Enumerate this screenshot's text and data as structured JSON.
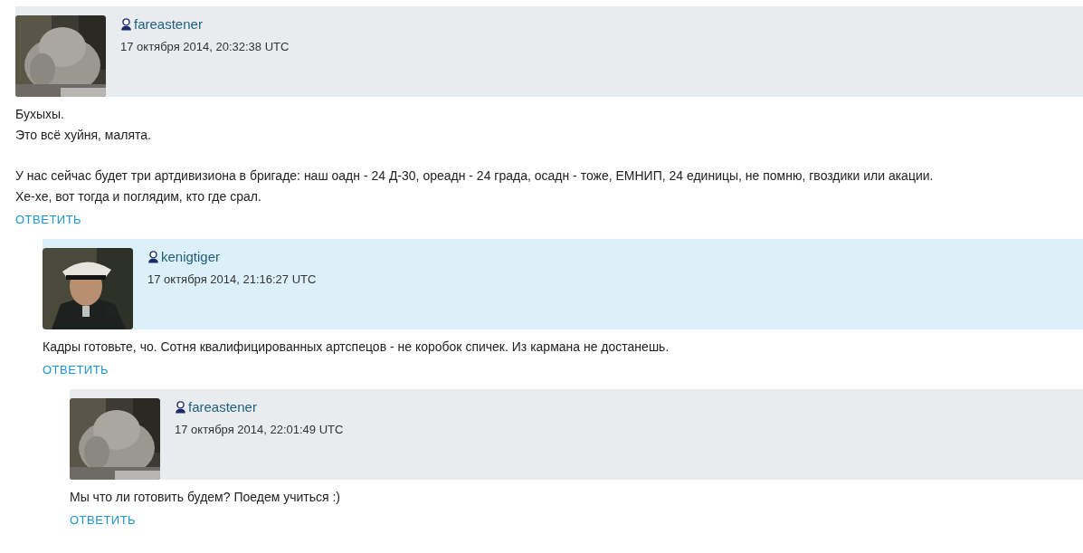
{
  "comments": [
    {
      "author": "fareastener",
      "date": "17 октября 2014, 20:32:38 UTC",
      "highlighted": false,
      "avatar": {
        "kind": "picture"
      },
      "paragraphs": [
        [
          "Бухыхы.",
          "Это всё хуйня, малята."
        ],
        [
          "У нас сейчас будет три артдивизиона в бригаде: наш оадн - 24 Д-30, ореадн - 24 града, осадн - тоже, ЕМНИП, 24 единицы, не помню, гвоздики или акации.",
          "Хе-хе, вот тогда и поглядим, кто где срал."
        ]
      ],
      "reply": "ОТВЕТИТЬ",
      "children": [
        {
          "author": "kenigtiger",
          "date": "17 октября 2014, 21:16:27 UTC",
          "highlighted": true,
          "avatar": {
            "kind": "picture"
          },
          "paragraphs": [
            [
              "Кадры готовьте, чо. Сотня квалифицированных артспецов - не коробок спичек. Из кармана не достанешь."
            ]
          ],
          "reply": "ОТВЕТИТЬ",
          "children": [
            {
              "author": "fareastener",
              "date": "17 октября 2014, 22:01:49 UTC",
              "highlighted": false,
              "avatar": {
                "kind": "picture"
              },
              "paragraphs": [
                [
                  "Мы что ли готовить будем? Поедем учиться :)"
                ]
              ],
              "reply": "ОТВЕТИТЬ"
            }
          ]
        }
      ]
    }
  ]
}
